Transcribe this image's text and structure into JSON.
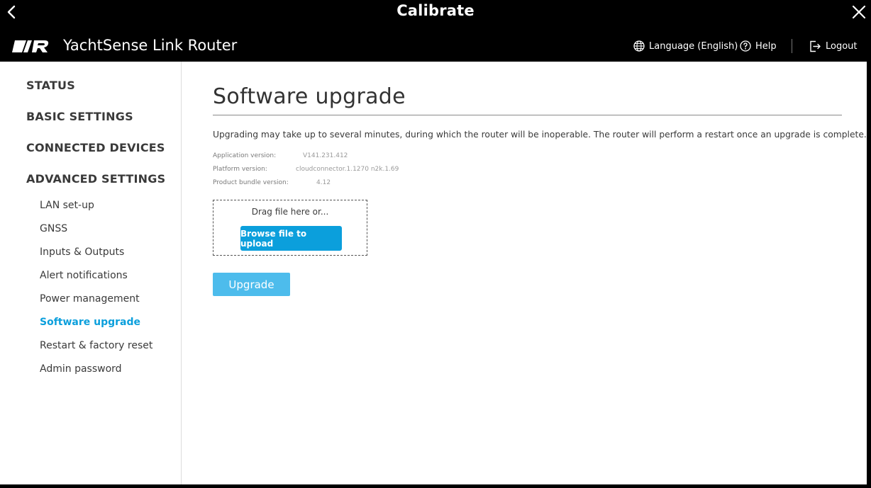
{
  "window": {
    "title": "Calibrate"
  },
  "header": {
    "app_title": "YachtSense Link Router",
    "language_label": "Language (English)",
    "help_label": "Help",
    "logout_label": "Logout"
  },
  "sidebar": {
    "status": "STATUS",
    "basic_settings": "BASIC SETTINGS",
    "connected_devices": "CONNECTED DEVICES",
    "advanced_settings": "ADVANCED SETTINGS",
    "sub_items": [
      {
        "label": "LAN set-up",
        "active": false
      },
      {
        "label": "GNSS",
        "active": false
      },
      {
        "label": "Inputs & Outputs",
        "active": false
      },
      {
        "label": "Alert notifications",
        "active": false
      },
      {
        "label": "Power management",
        "active": false
      },
      {
        "label": "Software upgrade",
        "active": true
      },
      {
        "label": "Restart & factory reset",
        "active": false
      },
      {
        "label": "Admin password",
        "active": false
      }
    ]
  },
  "main": {
    "title": "Software upgrade",
    "description": "Upgrading may take up to several minutes, during which the router will be inoperable. The router will perform a restart once an upgrade is complete.",
    "versions": [
      {
        "label": "Application version:",
        "value": "V141.231.412"
      },
      {
        "label": "Platform version:",
        "value": "cloudconnector.1.1270 n2k.1.69"
      },
      {
        "label": "Product bundle version:",
        "value": "4.12"
      }
    ],
    "drop_text": "Drag file here or...",
    "browse_label": "Browse file to upload",
    "upgrade_label": "Upgrade"
  },
  "colors": {
    "accent": "#0b9fdc",
    "upgrade_button": "#4dbcec",
    "header_bg": "#000000"
  }
}
